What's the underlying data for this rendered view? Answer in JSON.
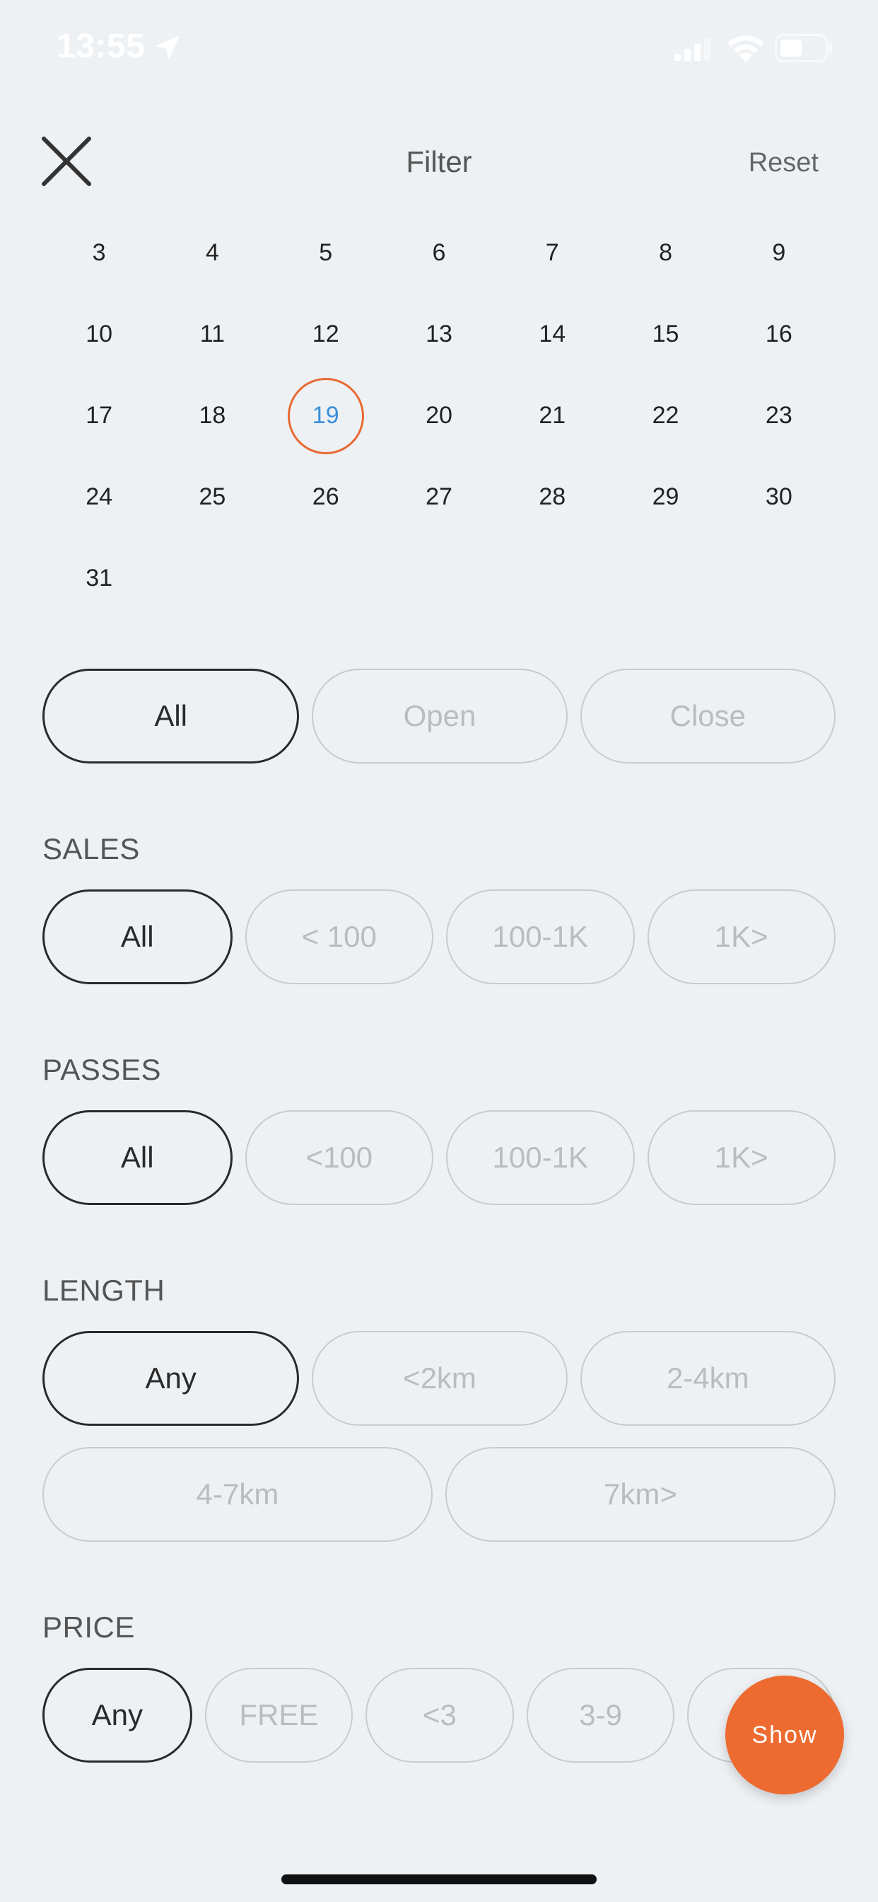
{
  "status_bar": {
    "time": "13:55"
  },
  "header": {
    "title": "Filter",
    "reset_label": "Reset"
  },
  "calendar": {
    "weeks": [
      [
        "3",
        "4",
        "5",
        "6",
        "7",
        "8",
        "9"
      ],
      [
        "10",
        "11",
        "12",
        "13",
        "14",
        "15",
        "16"
      ],
      [
        "17",
        "18",
        "19",
        "20",
        "21",
        "22",
        "23"
      ],
      [
        "24",
        "25",
        "26",
        "27",
        "28",
        "29",
        "30"
      ],
      [
        "31",
        "",
        "",
        "",
        "",
        "",
        ""
      ]
    ],
    "selected_day": "19"
  },
  "status_filter": {
    "options": [
      "All",
      "Open",
      "Close"
    ],
    "selected": "All"
  },
  "sales": {
    "label": "SALES",
    "options": [
      "All",
      "< 100",
      "100-1K",
      "1K>"
    ],
    "selected": "All"
  },
  "passes": {
    "label": "PASSES",
    "options": [
      "All",
      "<100",
      "100-1K",
      "1K>"
    ],
    "selected": "All"
  },
  "length": {
    "label": "LENGTH",
    "options": [
      "Any",
      "<2km",
      "2-4km",
      "4-7km",
      "7km>"
    ],
    "selected": "Any"
  },
  "price": {
    "label": "PRICE",
    "options": [
      "Any",
      "FREE",
      "<3",
      "3-9",
      ""
    ],
    "selected": "Any"
  },
  "show_label": "Show",
  "colors": {
    "accent": "#ed6a30",
    "selected_day_text": "#3a8fd9",
    "background": "#eef1f4"
  }
}
